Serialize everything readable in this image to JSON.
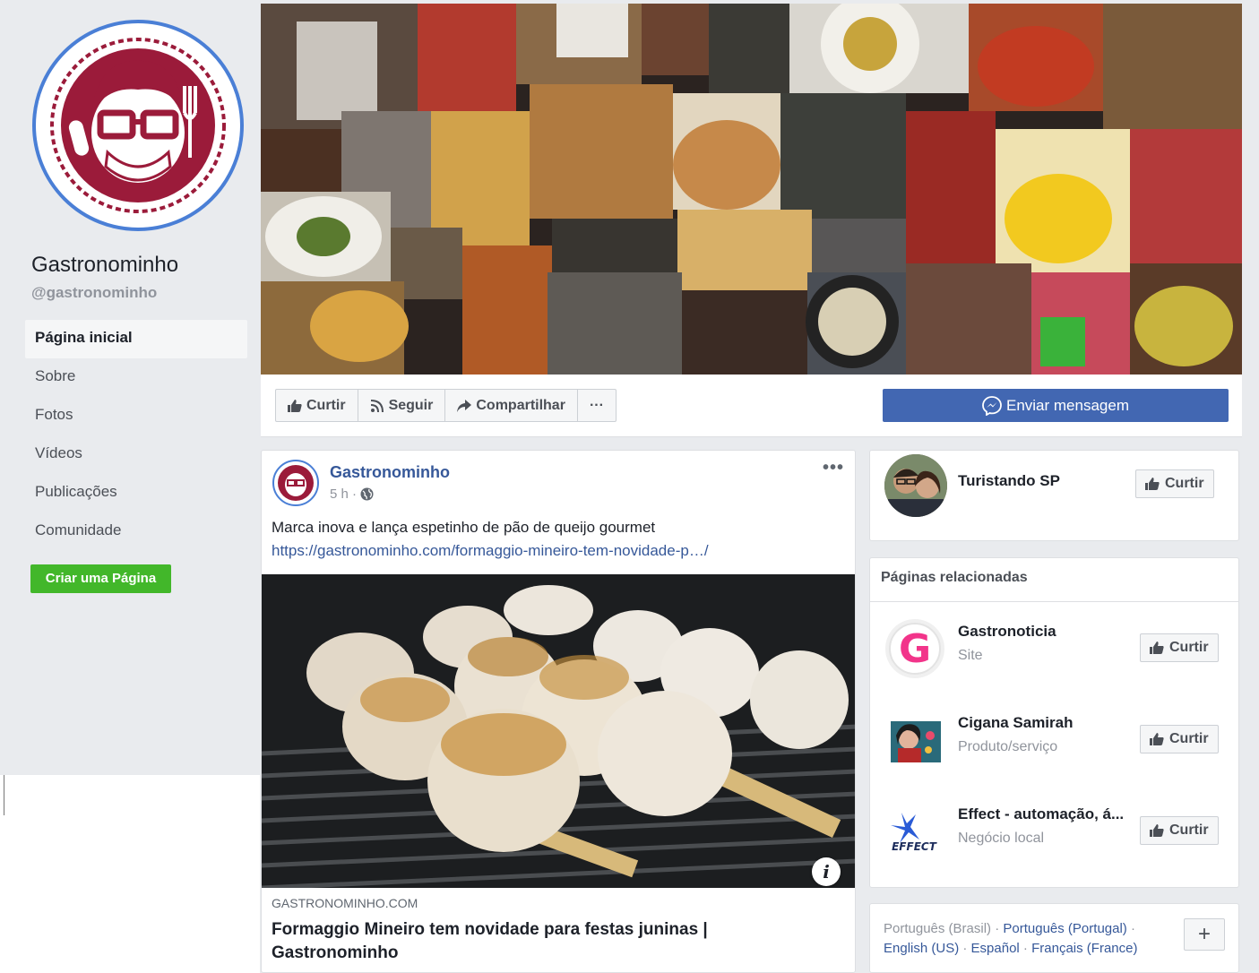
{
  "sidebar": {
    "page_name": "Gastronominho",
    "handle": "@gastronominho",
    "nav": [
      "Página inicial",
      "Sobre",
      "Fotos",
      "Vídeos",
      "Publicações",
      "Comunidade"
    ],
    "create_page": "Criar uma Página"
  },
  "actions": {
    "like": "Curtir",
    "follow": "Seguir",
    "share": "Compartilhar",
    "more": "···",
    "message": "Enviar mensagem"
  },
  "post": {
    "author": "Gastronominho",
    "time": "5 h ·",
    "more": "•••",
    "text": "Marca inova e lança espetinho de pão de queijo gourmet",
    "link": "https://gastronominho.com/formaggio-mineiro-tem-novidade-p…/",
    "info": "i",
    "domain": "GASTRONOMINHO.COM",
    "title": "Formaggio Mineiro tem novidade para festas juninas | Gastronominho"
  },
  "suggested": {
    "name": "Turistando SP",
    "like": "Curtir"
  },
  "related": {
    "heading": "Páginas relacionadas",
    "items": [
      {
        "name": "Gastronoticia",
        "category": "Site",
        "like": "Curtir"
      },
      {
        "name": "Cigana Samirah",
        "category": "Produto/serviço",
        "like": "Curtir"
      },
      {
        "name": "Effect - automação, á...",
        "category": "Negócio local",
        "like": "Curtir"
      }
    ]
  },
  "languages": {
    "current": "Português (Brasil)",
    "sep": " · ",
    "links": [
      "Português (Portugal)",
      "English (US)",
      "Español",
      "Français (France)"
    ],
    "plus": "+"
  },
  "logos": {
    "effect_text": "EFFECT",
    "g_letter": "G"
  },
  "colors": {
    "brand_red": "#9b1b3a",
    "facebook_blue": "#4267b2",
    "link_blue": "#365899",
    "create_green": "#42b72a"
  }
}
